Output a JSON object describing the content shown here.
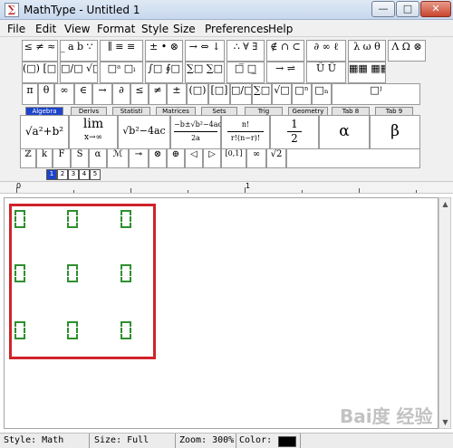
{
  "window": {
    "title": "MathType - Untitled 1",
    "controls": {
      "minimize": "—",
      "maximize": "□",
      "close": "✕"
    }
  },
  "menu": [
    "File",
    "Edit",
    "View",
    "Format",
    "Style",
    "Size",
    "Preferences",
    "Help"
  ],
  "palette_row1": [
    "≤ ≠ ≈",
    "̲ a b ∵",
    "∥ ≡ ≡",
    "± • ⊗",
    "→ ⇔ ↓",
    "∴ ∀ ∃",
    "∉ ∩ ⊂",
    "∂ ∞ ℓ",
    "λ ω θ",
    "Λ Ω ⊗"
  ],
  "palette_row2": [
    "(□) [□]",
    "□/□ √□",
    "□ᵃ □ᵢ",
    "∫□ ∮□",
    "∑□ ∑□",
    "□̅ □̲",
    "→ ⇌",
    "Ũ Ü",
    "▦▦ ▦▦"
  ],
  "palette_row3": [
    "π",
    "θ",
    "∞",
    "∈",
    "→",
    "∂",
    "≤",
    "≠",
    "±",
    "(□)",
    "[□]",
    "□/□",
    "∑□",
    "√□",
    "□ⁿ",
    "□ₙ",
    "□ʲ"
  ],
  "tabs": [
    "Algebra",
    "Derivs",
    "Statisti",
    "Matrices",
    "Sets",
    "Trig",
    "Geometry",
    "Tab 8",
    "Tab 9"
  ],
  "templates": {
    "t1": "√a²+b²",
    "t2_top": "lim",
    "t2_bottom": "x→∞",
    "t3": "√b²−4ac",
    "t4_top": "−b±√b²−4ac",
    "t4_bottom": "2a",
    "t5_top": "n!",
    "t5_bottom": "r!(n−r)!",
    "t6_top": "1",
    "t6_bottom": "2",
    "t7": "α",
    "t8": "β"
  },
  "palette_row5": [
    "ℤ",
    "k",
    "F",
    "S",
    "α",
    "ℳ",
    "⊸",
    "⊗",
    "⊕",
    "◁",
    "▷",
    "[0,1]",
    "∞",
    "√2"
  ],
  "small_buttons": [
    "1",
    "2",
    "3",
    "4",
    "5"
  ],
  "ruler": {
    "mark0": "0",
    "mark1": "1"
  },
  "statusbar": {
    "style": "Style: Math",
    "size": "Size: Full",
    "zoom": "Zoom: 300%",
    "color": "Color:"
  },
  "colors": {
    "highlight": "#d0232a",
    "slot": "#2f8f2f",
    "tab_active": "#1d43c9"
  },
  "watermark": "Bai度 经验"
}
